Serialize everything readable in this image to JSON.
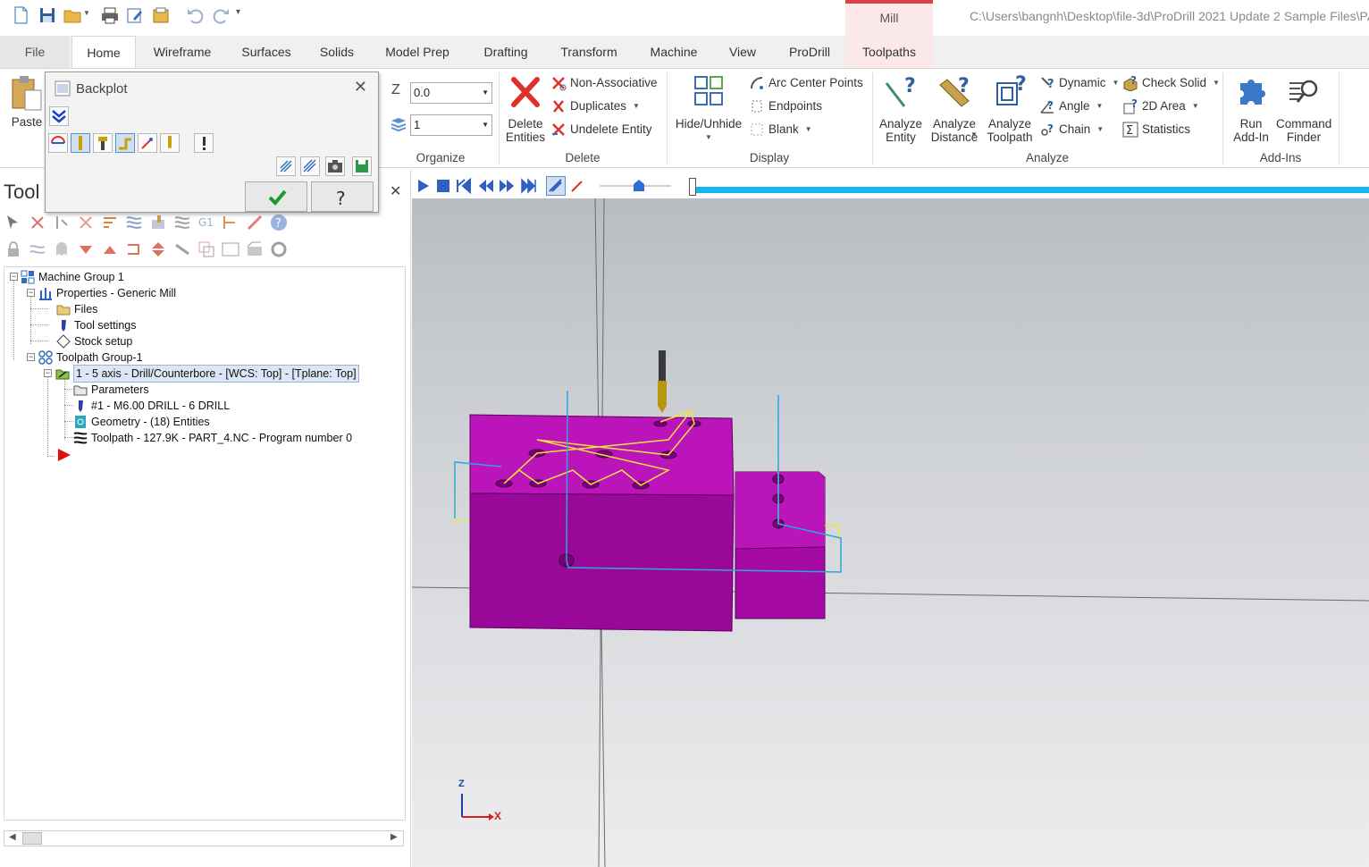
{
  "window": {
    "title_path": "C:\\Users\\bangnh\\Desktop\\file-3d\\ProDrill 2021 Update 2 Sample Files\\PA",
    "context_tab": "Mill"
  },
  "tabs": [
    "File",
    "Home",
    "Wireframe",
    "Surfaces",
    "Solids",
    "Model Prep",
    "Drafting",
    "Transform",
    "Machine",
    "View",
    "ProDrill",
    "Toolpaths"
  ],
  "active_tab": "Home",
  "ribbon": {
    "clipboard": {
      "paste": "Paste"
    },
    "organize": {
      "label": "Organize",
      "z_label": "Z",
      "z_value": "0.0",
      "level_value": "1"
    },
    "delete": {
      "label": "Delete",
      "delete_entities_1": "Delete",
      "delete_entities_2": "Entities",
      "non_associative": "Non-Associative",
      "duplicates": "Duplicates",
      "undelete_entity": "Undelete Entity"
    },
    "display": {
      "label": "Display",
      "hide_unhide": "Hide/Unhide",
      "arc_center_points": "Arc Center Points",
      "endpoints": "Endpoints",
      "blank": "Blank"
    },
    "analyze": {
      "label": "Analyze",
      "analyze_entity_1": "Analyze",
      "analyze_entity_2": "Entity",
      "analyze_distance_1": "Analyze",
      "analyze_distance_2": "Distance",
      "analyze_toolpath_1": "Analyze",
      "analyze_toolpath_2": "Toolpath",
      "dynamic": "Dynamic",
      "angle": "Angle",
      "chain": "Chain",
      "check_solid": "Check Solid",
      "area_2d": "2D Area",
      "statistics": "Statistics"
    },
    "addins": {
      "label": "Add-Ins",
      "run_addin_1": "Run",
      "run_addin_2": "Add-In",
      "command_finder_1": "Command",
      "command_finder_2": "Finder"
    }
  },
  "backplot": {
    "title": "Backplot"
  },
  "panel": {
    "title": "Tool",
    "tree": [
      "Machine Group 1",
      "Properties - Generic Mill",
      "Files",
      "Tool settings",
      "Stock setup",
      "Toolpath Group-1",
      "1 - 5 axis - Drill/Counterbore - [WCS: Top] - [Tplane: Top]",
      "Parameters",
      "#1 - M6.00 DRILL - 6 DRILL",
      "Geometry - (18) Entities",
      "Toolpath - 127.9K - PART_4.NC - Program number 0"
    ]
  },
  "viewport": {
    "axis_z": "Z",
    "axis_x": "X"
  },
  "colors": {
    "part": "#a50aa5",
    "toolpath_rapid": "#f2e23a",
    "toolpath_feed": "#2aa8e0",
    "accent": "#d9414a",
    "playbar_track": "#16b4f0"
  }
}
